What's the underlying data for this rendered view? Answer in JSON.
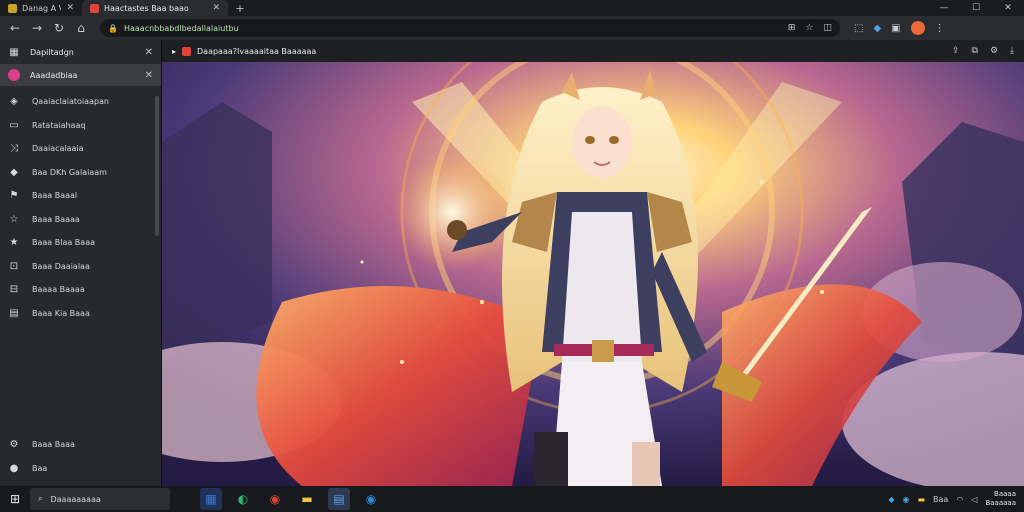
{
  "tabs": [
    {
      "title": "Danag A Vaom",
      "favicon_color": "#c9a227",
      "active": false
    },
    {
      "title": "Haactastes Baa baao",
      "favicon_color": "#e0453a",
      "active": true
    }
  ],
  "window_controls": {
    "minimize": "—",
    "maximize": "☐",
    "close": "✕"
  },
  "addressbar": {
    "url": "Haaacnbbabdlbedallalaiutbu"
  },
  "sidebar": {
    "header": "Dapiltadgn",
    "selected": "Aaadadbiaa",
    "items": [
      {
        "icon": "cube-icon",
        "glyph": "◈",
        "label": "Qaaiaclaiatoiaapan"
      },
      {
        "icon": "chat-icon",
        "glyph": "▭",
        "label": "Ratataiahaaq"
      },
      {
        "icon": "shuffle-icon",
        "glyph": "⤨",
        "label": "Daaiacaiaaia"
      },
      {
        "icon": "pin-icon",
        "glyph": "◆",
        "label": "Baa DKh Galaiaam"
      },
      {
        "icon": "flag-icon",
        "glyph": "⚑",
        "label": "Baaa Baaal"
      },
      {
        "icon": "star-outline-icon",
        "glyph": "☆",
        "label": "Baaa Baaaa"
      },
      {
        "icon": "star-icon",
        "glyph": "★",
        "label": "Baaa Blaa Baaa"
      },
      {
        "icon": "gamepad-icon",
        "glyph": "⊡",
        "label": "Baaa Daaialaa"
      },
      {
        "icon": "lock-icon",
        "glyph": "⊟",
        "label": "Baaaa Baaaa"
      },
      {
        "icon": "bag-icon",
        "glyph": "▤",
        "label": "Baaa Kia Baaa"
      }
    ],
    "bottom": [
      {
        "icon": "settings-icon",
        "glyph": "⚙",
        "label": "Baaa Baaa"
      },
      {
        "icon": "person-icon",
        "glyph": "●",
        "label": "Baa"
      }
    ]
  },
  "content_tab": {
    "title": "Daapaaa?Ivaaaaitaa Baaaaaa",
    "favicon_color": "#e0453a"
  },
  "taskbar": {
    "search_text": "Daaaaaaaaa",
    "apps": [
      {
        "icon": "store-icon",
        "glyph": "▦",
        "color": "#3a7bd5",
        "bg": "#20315a"
      },
      {
        "icon": "edge-icon",
        "glyph": "◐",
        "color": "#2bb673",
        "bg": "#18191c"
      },
      {
        "icon": "media-icon",
        "glyph": "◉",
        "color": "#e0453a",
        "bg": "#18191c"
      },
      {
        "icon": "folder-icon",
        "glyph": "▬",
        "color": "#f2c14e",
        "bg": "#18191c"
      },
      {
        "icon": "notepad-icon",
        "glyph": "▤",
        "color": "#5aa0e6",
        "bg": "#2e3a52"
      },
      {
        "icon": "browser-icon",
        "glyph": "◉",
        "color": "#2a8be0",
        "bg": "#18191c"
      }
    ],
    "tray_text": "Baa",
    "time": "Baaaa",
    "date": "Baaaaaa"
  }
}
